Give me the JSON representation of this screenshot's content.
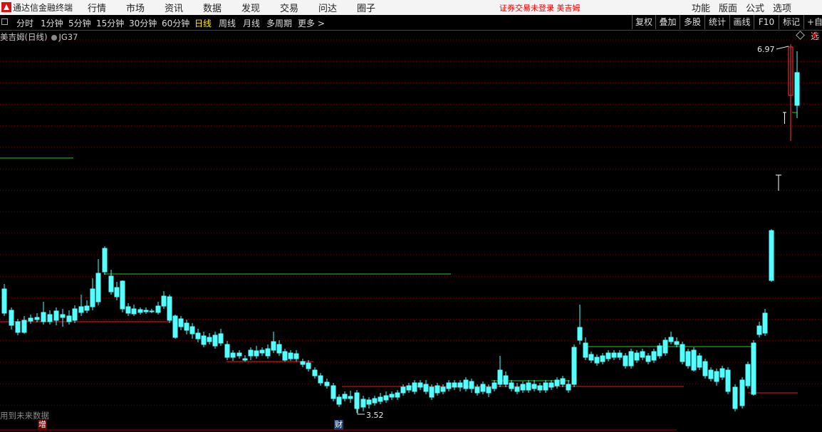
{
  "menubar": {
    "app_name": "通达信金融终端",
    "items": [
      "行情",
      "市场",
      "资讯",
      "数据",
      "发现",
      "交易",
      "问达",
      "圈子"
    ],
    "warning": "证券交易未登录  美吉姆",
    "right_items": [
      "功能",
      "版面",
      "公式",
      "选项"
    ]
  },
  "toolbar": {
    "periods": [
      "分时",
      "1分钟",
      "5分钟",
      "15分钟",
      "30分钟",
      "60分钟",
      "日线",
      "周线",
      "月线",
      "多周期",
      "更多 >"
    ],
    "active_period": "日线",
    "right_buttons": [
      "复权",
      "叠加",
      "多股",
      "统计",
      "画线",
      "F10",
      "标记",
      "+自选"
    ]
  },
  "chart": {
    "title": "美吉姆(日线)",
    "indicator": "JG37",
    "high_label": "6.97",
    "low_label": "3.52",
    "footnote": "用到未来数据",
    "tag_zeng": "增",
    "tag_cai": "财",
    "colors": {
      "up": "#ff3b3b",
      "down": "#54ffff",
      "grid": "#7a0000",
      "green_line": "#22d022",
      "red_line": "#e81a1a"
    }
  }
}
